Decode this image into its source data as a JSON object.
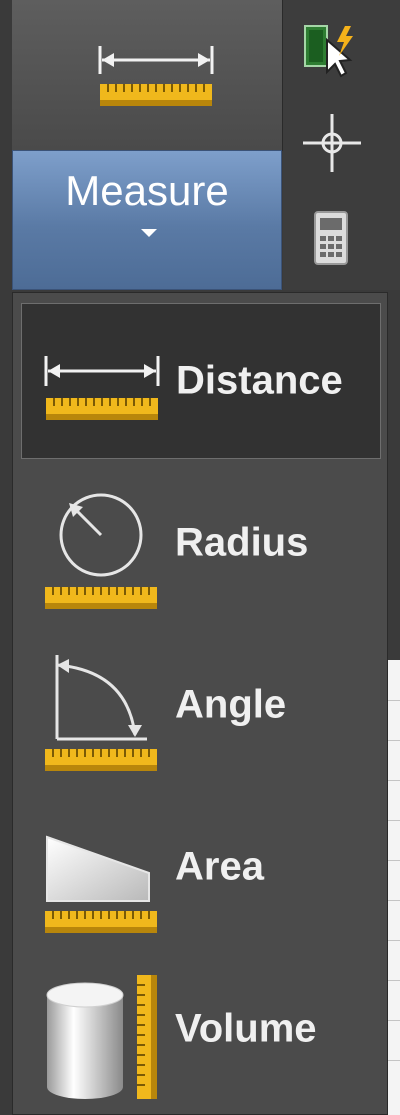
{
  "ribbon": {
    "measure_button": {
      "label": "Measure",
      "icon": "measure-distance-icon",
      "dropdown_indicator": "caret-down-icon"
    },
    "side_icons": [
      "quick-select-icon",
      "crosshair-icon",
      "calculator-icon"
    ]
  },
  "dropdown": {
    "selected": "Distance",
    "items": [
      {
        "label": "Distance",
        "icon": "distance-icon"
      },
      {
        "label": "Radius",
        "icon": "radius-icon"
      },
      {
        "label": "Angle",
        "icon": "angle-icon"
      },
      {
        "label": "Area",
        "icon": "area-icon"
      },
      {
        "label": "Volume",
        "icon": "volume-icon"
      }
    ]
  },
  "colors": {
    "ruler_yellow": "#f0b81c",
    "button_blue": "#6a8bb8",
    "panel_dark": "#4b4b4b"
  }
}
